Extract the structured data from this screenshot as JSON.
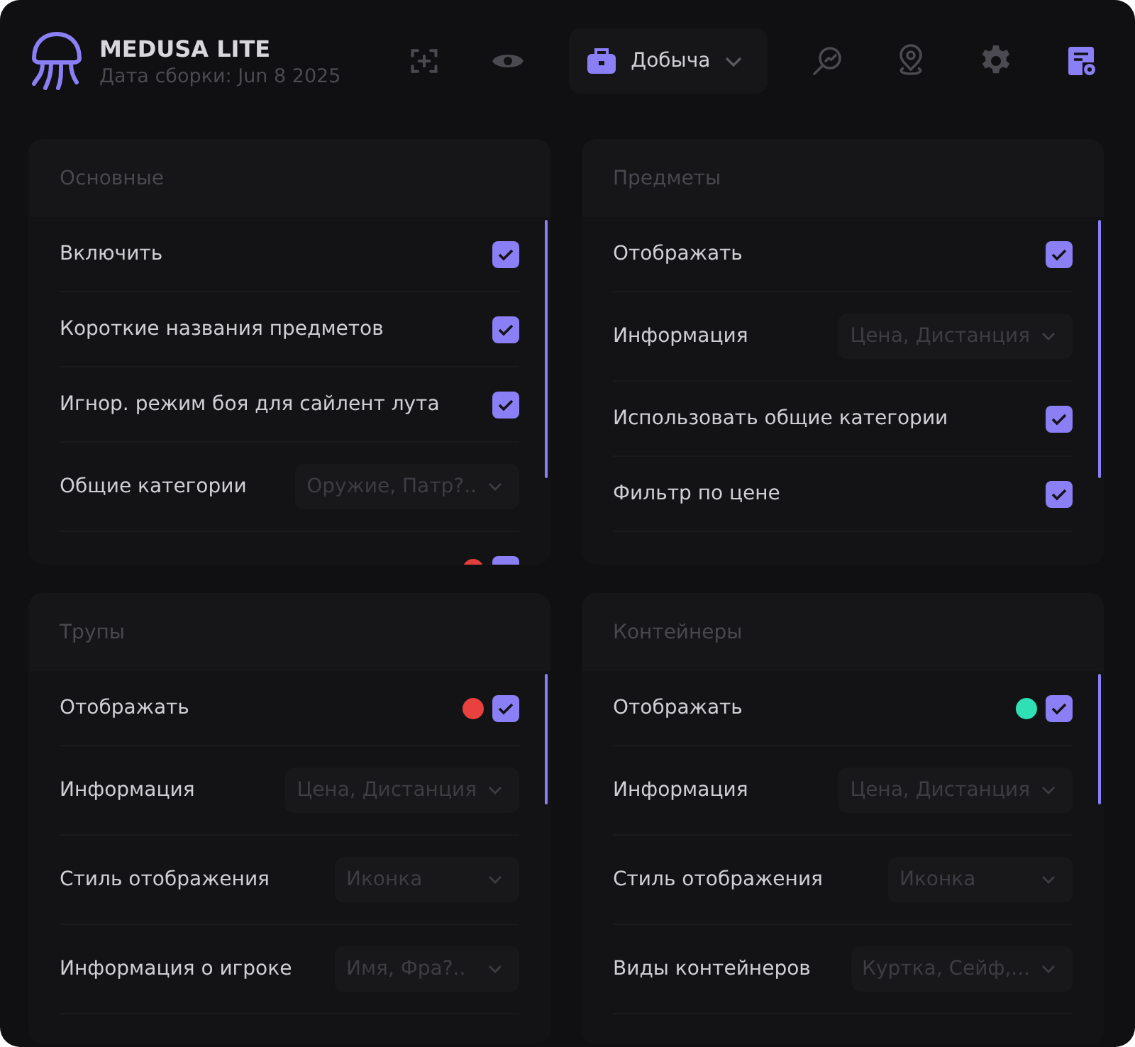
{
  "app": {
    "title": "MEDUSA LITE",
    "build": "Дата сборки: Jun 8 2025"
  },
  "toolbar": [
    {
      "kind": "icon",
      "selected": false
    },
    {
      "kind": "icon",
      "selected": false
    },
    {
      "kind": "dropdown",
      "label": "Добыча",
      "selected": true
    },
    {
      "kind": "icon",
      "selected": false
    },
    {
      "kind": "icon",
      "selected": false
    },
    {
      "kind": "icon",
      "selected": false
    },
    {
      "kind": "icon",
      "selected": true
    }
  ],
  "panels": [
    {
      "title": "Основные",
      "rows": [
        {
          "kind": "checkbox",
          "label": "Включить",
          "checked": true
        },
        {
          "kind": "checkbox",
          "label": "Короткие названия предметов",
          "checked": true
        },
        {
          "kind": "checkbox",
          "label": "Игнор. режим боя для сайлент лута",
          "checked": true
        },
        {
          "kind": "select",
          "label": "Общие категории",
          "value": "Оружие, Патр?.."
        },
        {
          "kind": "checkbox",
          "checked": true,
          "color": "#e0403c"
        }
      ]
    },
    {
      "title": "Предметы",
      "rows": [
        {
          "kind": "checkbox",
          "label": "Отображать",
          "checked": true
        },
        {
          "kind": "select",
          "label": "Информация",
          "value": "Цена, Дистанция"
        },
        {
          "kind": "checkbox",
          "label": "Использовать общие категории",
          "checked": true
        },
        {
          "kind": "checkbox",
          "label": "Фильтр по цене",
          "checked": true
        }
      ]
    },
    {
      "title": "Трупы",
      "rows": [
        {
          "kind": "checkbox",
          "label": "Отображать",
          "checked": true,
          "color": "#e8413e"
        },
        {
          "kind": "select",
          "label": "Информация",
          "value": "Цена, Дистанция"
        },
        {
          "kind": "select",
          "label": "Стиль отображения",
          "value": "Иконка"
        },
        {
          "kind": "select",
          "label": "Информация о игроке",
          "value": "Имя, Фра?.."
        }
      ]
    },
    {
      "title": "Контейнеры",
      "rows": [
        {
          "kind": "checkbox",
          "label": "Отображать",
          "checked": true,
          "color": "#2fe0b4"
        },
        {
          "kind": "select",
          "label": "Информация",
          "value": "Цена, Дистанция"
        },
        {
          "kind": "select",
          "label": "Стиль отображения",
          "value": "Иконка"
        },
        {
          "kind": "select",
          "label": "Виды контейнеров",
          "value": "Куртка, Сейф,..."
        }
      ]
    }
  ]
}
